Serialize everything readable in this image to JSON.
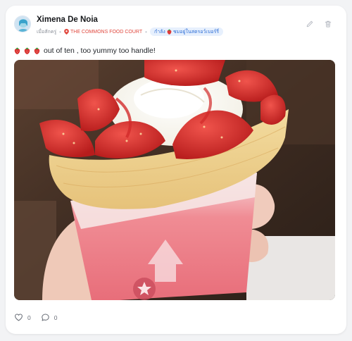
{
  "post": {
    "author": "Ximena De Noia",
    "time_label": "เมื่อสักครู่",
    "location": "THE COMMONS FOOD COURT",
    "status_prefix": "กำลัง",
    "status_text": "ชมอยู่ในสตรอว์เบอร์รี่",
    "caption": "out of ten , too yummy too handle!",
    "caption_emoji": "strawberry",
    "caption_emoji_count": 3,
    "photo_subject": "strawberry crepe cone held in hand",
    "likes": "0",
    "comments": "0"
  },
  "icons": {
    "edit": "pencil-icon",
    "delete": "trash-icon",
    "like": "heart-icon",
    "comment": "comment-bubble-icon",
    "location": "pin-icon"
  },
  "colors": {
    "accent_blue": "#2f6fd6",
    "location_red": "#e0483e",
    "badge_bg": "#e7f0fd"
  }
}
